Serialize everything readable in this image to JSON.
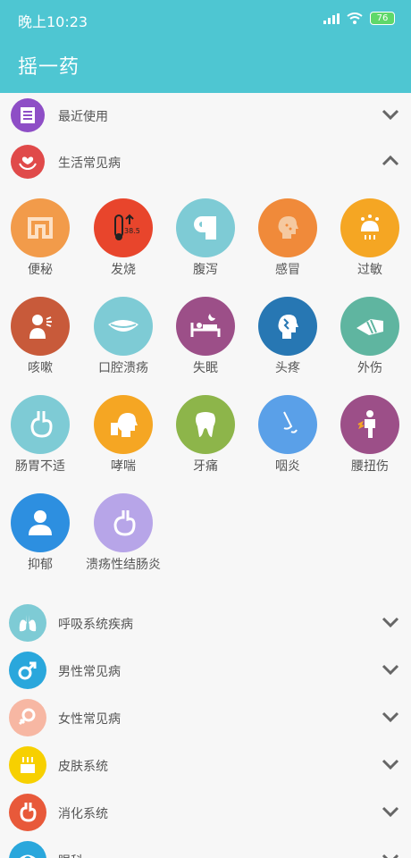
{
  "status": {
    "time": "晚上10:23",
    "battery": "76"
  },
  "appbar": {
    "title": "摇一药"
  },
  "sections": {
    "recent": "最近使用",
    "common": "生活常见病",
    "respiratory": "呼吸系统疾病",
    "male": "男性常见病",
    "female": "女性常见病",
    "skin": "皮肤系统",
    "digestive": "消化系统",
    "eye": "眼科"
  },
  "diseases": [
    {
      "label": "便秘",
      "color": "#f29b4a",
      "icon": "intestine-icon"
    },
    {
      "label": "发烧",
      "color": "#e8452c",
      "icon": "thermometer-icon"
    },
    {
      "label": "腹泻",
      "color": "#7ecbd5",
      "icon": "toilet-paper-icon"
    },
    {
      "label": "感冒",
      "color": "#f08a3a",
      "icon": "cold-head-icon"
    },
    {
      "label": "过敏",
      "color": "#f5a623",
      "icon": "allergy-icon"
    },
    {
      "label": "咳嗽",
      "color": "#c85a3a",
      "icon": "cough-icon"
    },
    {
      "label": "口腔溃疡",
      "color": "#7ecbd5",
      "icon": "mouth-icon"
    },
    {
      "label": "失眠",
      "color": "#9c4f88",
      "icon": "bed-moon-icon"
    },
    {
      "label": "头疼",
      "color": "#2777b3",
      "icon": "headache-icon"
    },
    {
      "label": "外伤",
      "color": "#5fb5a0",
      "icon": "bandage-arm-icon"
    },
    {
      "label": "肠胃不适",
      "color": "#7ecbd5",
      "icon": "stomach-icon"
    },
    {
      "label": "哮喘",
      "color": "#f5a623",
      "icon": "inhaler-icon"
    },
    {
      "label": "牙痛",
      "color": "#8db54a",
      "icon": "tooth-icon"
    },
    {
      "label": "咽炎",
      "color": "#5aa0e8",
      "icon": "throat-icon"
    },
    {
      "label": "腰扭伤",
      "color": "#9c4f88",
      "icon": "back-pain-icon"
    },
    {
      "label": "抑郁",
      "color": "#2d8fe0",
      "icon": "person-icon"
    },
    {
      "label": "溃疡性结肠炎",
      "color": "#b7a5e8",
      "icon": "colon-icon"
    }
  ],
  "colors": {
    "appbar": "#4ec6d2",
    "recent": "#8e4ec6",
    "common": "#e04a4a",
    "respiratory": "#7ecbd5",
    "male": "#2aa7dc",
    "female": "#f7b7a3",
    "skin": "#f7d000",
    "digestive": "#e8593a",
    "eye": "#2aa7dc"
  }
}
